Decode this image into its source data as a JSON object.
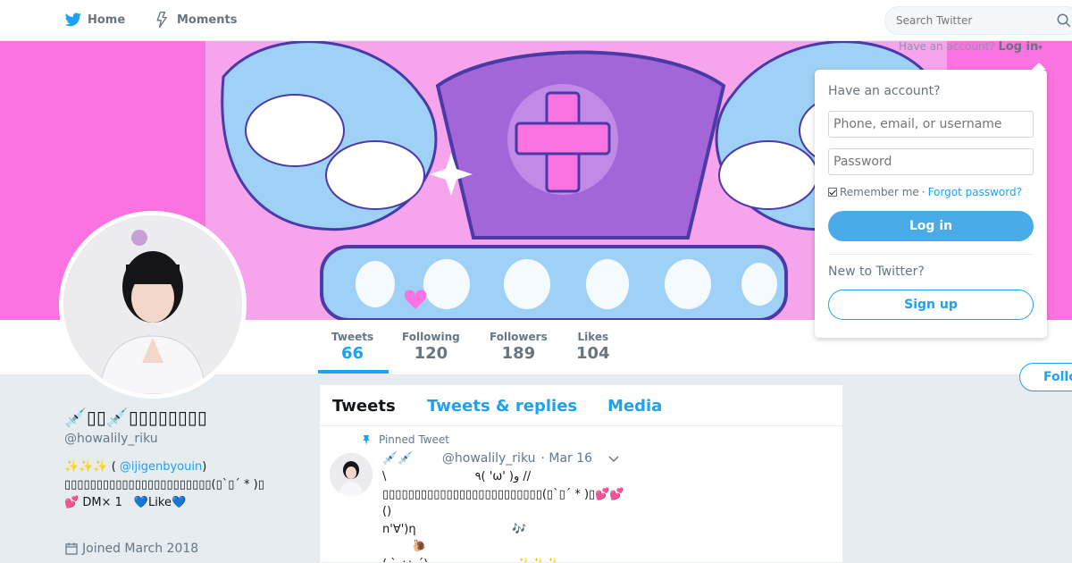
{
  "nav": {
    "home_label": "Home",
    "moments_label": "Moments",
    "search_placeholder": "Search Twitter"
  },
  "login_toggle": {
    "prompt": "Have an account?",
    "link": "Log in"
  },
  "login_panel": {
    "heading": "Have an account?",
    "username_placeholder": "Phone, email, or username",
    "password_placeholder": "Password",
    "remember_label": "Remember me",
    "separator": "·",
    "forgot_link": "Forgot password?",
    "login_button": "Log in",
    "new_label": "New to Twitter?",
    "signup_button": "Sign up"
  },
  "profile": {
    "name": "💉▯▯💉▯▯▯▯▯▯▯▯",
    "screen_name": "@howalily_riku",
    "bio": {
      "line1_prefix": "✨✨✨ (",
      "mention": "@ijigenbyouin",
      "line1_suffix": ")",
      "line2": "▯▯▯▯▯▯▯▯▯▯▯▯▯▯▯▯▯▯▯▯▯▯▯(▯`▯´ * )▯",
      "line3": "💕 DM× 1　💙Like💙"
    },
    "joined": "Joined March 2018"
  },
  "stats": {
    "tweets_label": "Tweets",
    "tweets_value": "66",
    "following_label": "Following",
    "following_value": "120",
    "followers_label": "Followers",
    "followers_value": "189",
    "likes_label": "Likes",
    "likes_value": "104"
  },
  "follow_button": "Follow",
  "timeline": {
    "tabs": [
      "Tweets",
      "Tweets & replies",
      "Media"
    ],
    "pinned_label": "Pinned Tweet",
    "tweet": {
      "author_emoji": "💉💉",
      "handle": "@howalily_riku",
      "date": "· Mar 16",
      "body": "\\                        ٩( 'ω' )و //\n▯▯▯▯▯▯▯▯▯▯▯▯▯▯▯▯▯▯▯▯▯▯▯▯▯(▯`▯´ * )▯💕💕\n()\nn'∀')η                          🎶\n        🐌\n( `･ω･´)                        ✨✨✨"
    }
  },
  "colors": {
    "accent": "#1da1f2",
    "banner_pink": "#fb73e1",
    "banner_purple": "#a366d9",
    "banner_lightblue": "#9fd0f5"
  }
}
